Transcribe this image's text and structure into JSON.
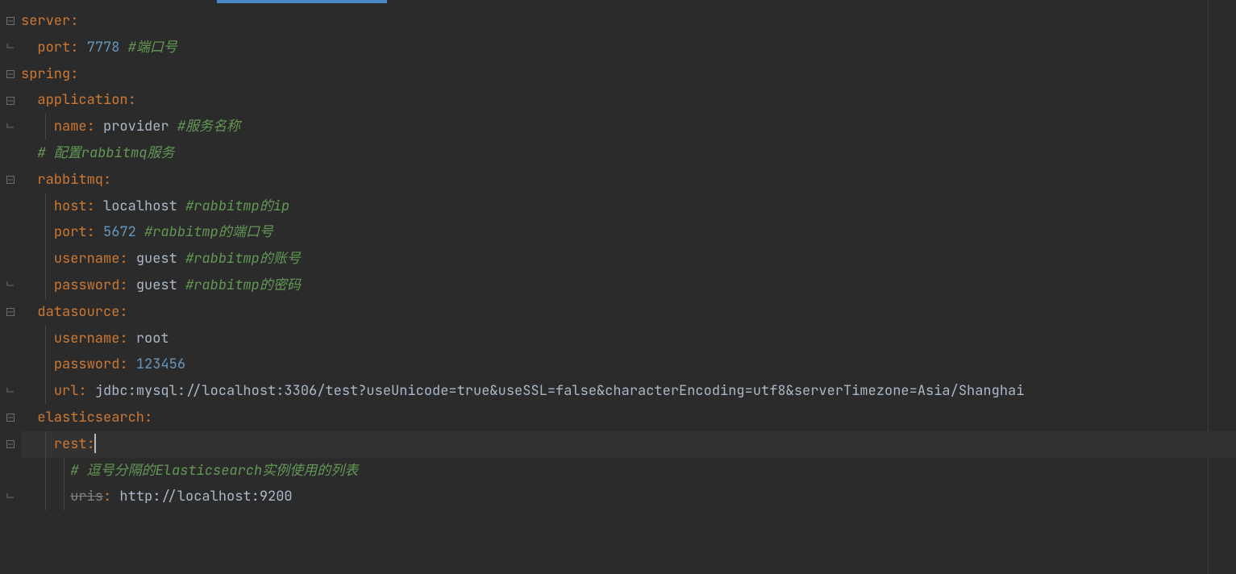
{
  "rightMargin": 1472,
  "lines": [
    {
      "fold": "minus",
      "indent": 0,
      "tokens": [
        {
          "t": "key",
          "v": "server"
        },
        {
          "t": "colon",
          "v": ":"
        }
      ]
    },
    {
      "fold": "close",
      "indent": 1,
      "tokens": [
        {
          "t": "key",
          "v": "port"
        },
        {
          "t": "colon",
          "v": ": "
        },
        {
          "t": "num",
          "v": "7778 "
        },
        {
          "t": "cmt",
          "v": "#端口号"
        }
      ]
    },
    {
      "fold": "minus",
      "indent": 0,
      "tokens": [
        {
          "t": "key",
          "v": "spring"
        },
        {
          "t": "colon",
          "v": ":"
        }
      ]
    },
    {
      "fold": "minus",
      "indent": 1,
      "tokens": [
        {
          "t": "key",
          "v": "application"
        },
        {
          "t": "colon",
          "v": ":"
        }
      ]
    },
    {
      "fold": "close",
      "indent": 2,
      "tokens": [
        {
          "t": "key",
          "v": "name"
        },
        {
          "t": "colon",
          "v": ": "
        },
        {
          "t": "str",
          "v": "provider "
        },
        {
          "t": "cmt",
          "v": "#服务名称"
        }
      ]
    },
    {
      "fold": "",
      "indent": 1,
      "tokens": [
        {
          "t": "cmt",
          "v": "# 配置rabbitmq服务"
        }
      ]
    },
    {
      "fold": "minus",
      "indent": 1,
      "tokens": [
        {
          "t": "key",
          "v": "rabbitmq"
        },
        {
          "t": "colon",
          "v": ":"
        }
      ]
    },
    {
      "fold": "",
      "indent": 2,
      "tokens": [
        {
          "t": "key",
          "v": "host"
        },
        {
          "t": "colon",
          "v": ": "
        },
        {
          "t": "str",
          "v": "localhost "
        },
        {
          "t": "cmt",
          "v": "#rabbitmp的ip"
        }
      ]
    },
    {
      "fold": "",
      "indent": 2,
      "tokens": [
        {
          "t": "key",
          "v": "port"
        },
        {
          "t": "colon",
          "v": ": "
        },
        {
          "t": "num",
          "v": "5672 "
        },
        {
          "t": "cmt",
          "v": "#rabbitmp的端口号"
        }
      ]
    },
    {
      "fold": "",
      "indent": 2,
      "tokens": [
        {
          "t": "key",
          "v": "username"
        },
        {
          "t": "colon",
          "v": ": "
        },
        {
          "t": "str",
          "v": "guest "
        },
        {
          "t": "cmt",
          "v": "#rabbitmp的账号"
        }
      ]
    },
    {
      "fold": "close",
      "indent": 2,
      "tokens": [
        {
          "t": "key",
          "v": "password"
        },
        {
          "t": "colon",
          "v": ": "
        },
        {
          "t": "str",
          "v": "guest "
        },
        {
          "t": "cmt",
          "v": "#rabbitmp的密码"
        }
      ]
    },
    {
      "fold": "minus",
      "indent": 1,
      "tokens": [
        {
          "t": "key",
          "v": "datasource"
        },
        {
          "t": "colon",
          "v": ":"
        }
      ]
    },
    {
      "fold": "",
      "indent": 2,
      "tokens": [
        {
          "t": "key",
          "v": "username"
        },
        {
          "t": "colon",
          "v": ": "
        },
        {
          "t": "str",
          "v": "root"
        }
      ]
    },
    {
      "fold": "",
      "indent": 2,
      "tokens": [
        {
          "t": "key",
          "v": "password"
        },
        {
          "t": "colon",
          "v": ": "
        },
        {
          "t": "num",
          "v": "123456"
        }
      ]
    },
    {
      "fold": "close",
      "indent": 2,
      "tokens": [
        {
          "t": "key",
          "v": "url"
        },
        {
          "t": "colon",
          "v": ": "
        },
        {
          "t": "urlval",
          "v": "jdbc:mysql://localhost:3306/test?useUnicode=true&useSSL=false&characterEncoding=utf8&serverTimezone=Asia/Shanghai"
        }
      ]
    },
    {
      "fold": "minus",
      "indent": 1,
      "tokens": [
        {
          "t": "key",
          "v": "elasticsearch"
        },
        {
          "t": "colon",
          "v": ":"
        }
      ]
    },
    {
      "fold": "minus",
      "indent": 2,
      "cursor": true,
      "tokens": [
        {
          "t": "key",
          "v": "rest"
        },
        {
          "t": "colon",
          "v": ":"
        },
        {
          "t": "caret",
          "v": ""
        }
      ]
    },
    {
      "fold": "",
      "indent": 3,
      "tokens": [
        {
          "t": "cmt",
          "v": "# 逗号分隔的Elasticsearch实例使用的列表"
        }
      ]
    },
    {
      "fold": "close",
      "indent": 3,
      "tokens": [
        {
          "t": "keyst",
          "v": "uris"
        },
        {
          "t": "colon",
          "v": ": "
        },
        {
          "t": "str",
          "v": "http://localhost:9200"
        }
      ]
    }
  ]
}
